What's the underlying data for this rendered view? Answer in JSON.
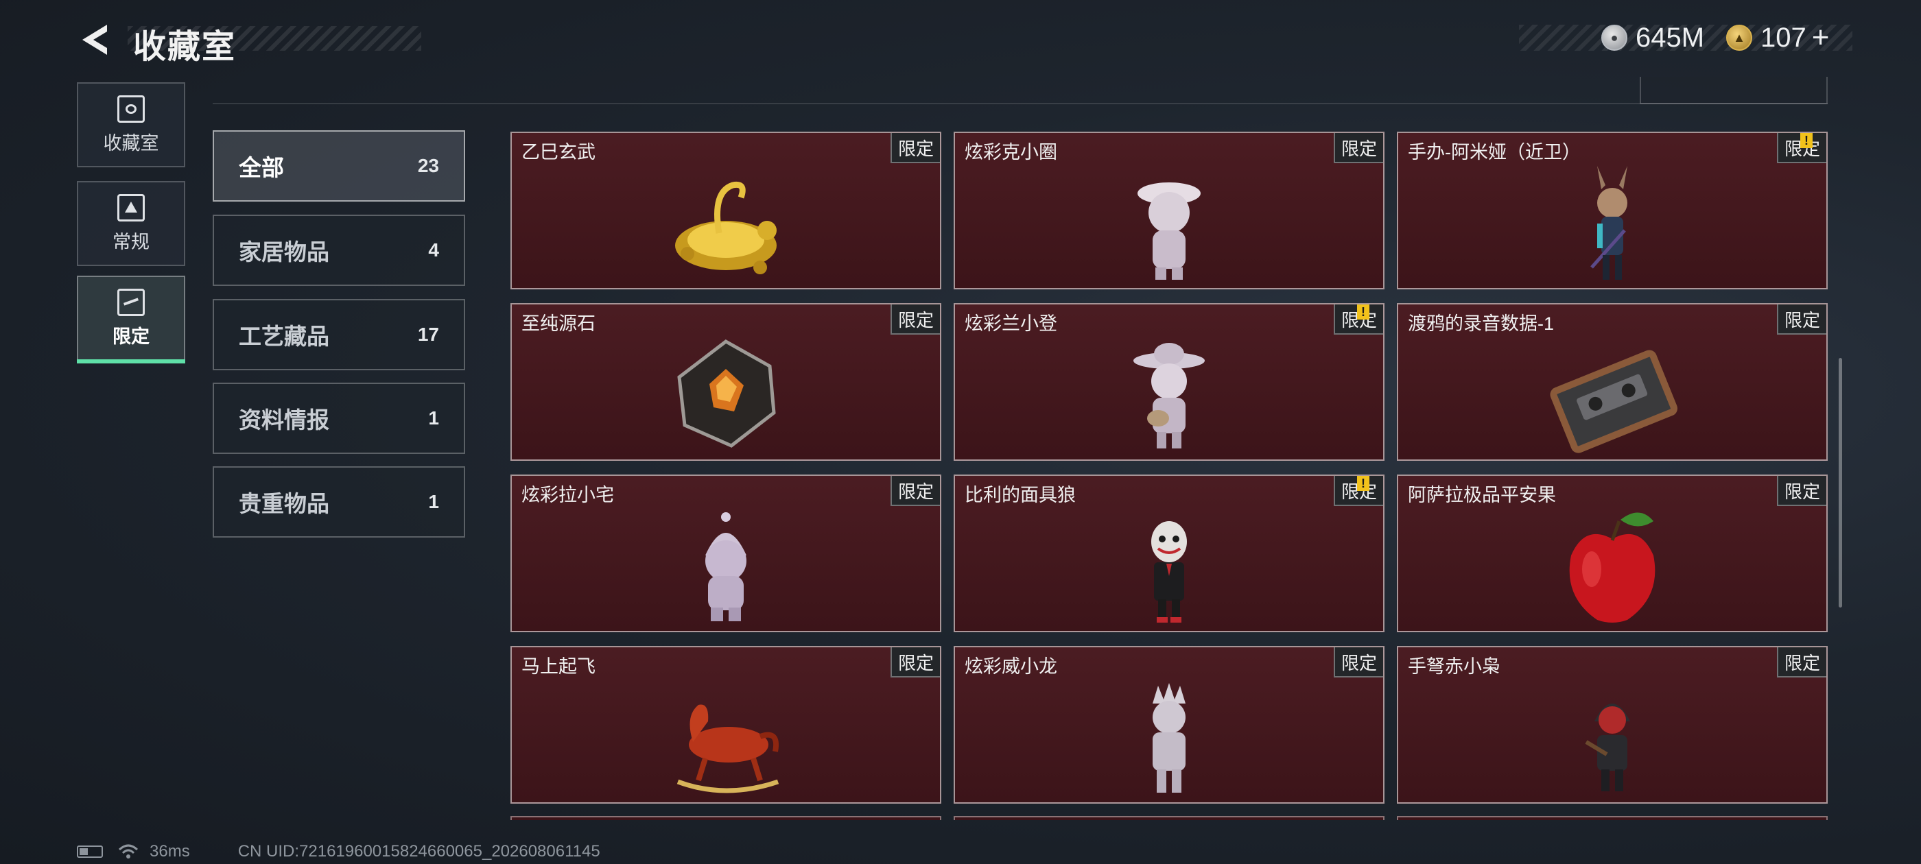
{
  "header": {
    "title": "收藏室"
  },
  "currency": {
    "silver_value": "645M",
    "gold_value": "107",
    "add_label": "+"
  },
  "nav": [
    {
      "label": "收藏室",
      "icon": "display-case-icon"
    },
    {
      "label": "常规",
      "icon": "card-icon"
    },
    {
      "label": "限定",
      "icon": "limited-icon",
      "active": true
    }
  ],
  "categories": [
    {
      "label": "全部",
      "count": "23",
      "active": true
    },
    {
      "label": "家居物品",
      "count": "4"
    },
    {
      "label": "工艺藏品",
      "count": "17"
    },
    {
      "label": "资料情报",
      "count": "1"
    },
    {
      "label": "贵重物品",
      "count": "1"
    }
  ],
  "items": [
    {
      "name": "乙巳玄武",
      "tag": "限定",
      "alert": false
    },
    {
      "name": "炫彩克小圈",
      "tag": "限定",
      "alert": false
    },
    {
      "name": "手办-阿米娅（近卫）",
      "tag": "限定",
      "alert": true
    },
    {
      "name": "至纯源石",
      "tag": "限定",
      "alert": false
    },
    {
      "name": "炫彩兰小登",
      "tag": "限定",
      "alert": true
    },
    {
      "name": "渡鸦的录音数据-1",
      "tag": "限定",
      "alert": false
    },
    {
      "name": "炫彩拉小宅",
      "tag": "限定",
      "alert": false
    },
    {
      "name": "比利的面具狼",
      "tag": "限定",
      "alert": true
    },
    {
      "name": "阿萨拉极品平安果",
      "tag": "限定",
      "alert": false
    },
    {
      "name": "马上起飞",
      "tag": "限定",
      "alert": false
    },
    {
      "name": "炫彩威小龙",
      "tag": "限定",
      "alert": false
    },
    {
      "name": "手弩赤小枭",
      "tag": "限定",
      "alert": false
    }
  ],
  "alert_mark": "!",
  "footer": {
    "ping": "36ms",
    "uid": "CN UID:72161960015824660065_202608061145"
  },
  "colors": {
    "card_bg": "#4b1c22",
    "active_accent": "#5fe0a8",
    "alert": "#f2c21b"
  }
}
